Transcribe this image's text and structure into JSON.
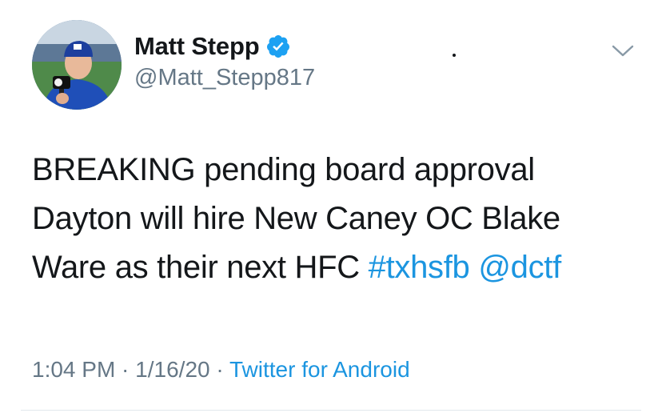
{
  "author": {
    "display_name": "Matt Stepp",
    "handle": "@Matt_Stepp817",
    "verified": true,
    "avatar_icon": "profile-photo"
  },
  "tweet": {
    "lines": [
      {
        "text": "BREAKING pending board approval"
      },
      {
        "text": "Dayton will hire New Caney OC Blake"
      },
      {
        "text_before": "Ware as their next HFC ",
        "hashtag": "#txhsfb",
        "space": " ",
        "mention": "@dctf"
      }
    ]
  },
  "meta": {
    "time": "1:04 PM",
    "separator": " · ",
    "date": "1/16/20",
    "source": "Twitter for Android"
  },
  "colors": {
    "link": "#1b95e0",
    "secondary_text": "#657786",
    "primary_text": "#14171a",
    "verified_badge": "#1da1f2"
  }
}
